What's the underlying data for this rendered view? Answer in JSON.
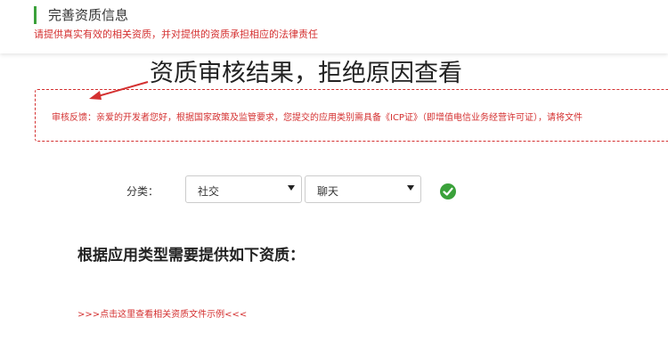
{
  "header": {
    "title": "完善资质信息",
    "subtitle": "请提供真实有效的相关资质，并对提供的资质承担相应的法律责任",
    "accent_color": "#3aa13a"
  },
  "annotation": {
    "text": "资质审核结果，拒绝原因查看"
  },
  "feedback": {
    "text": "审核反馈：亲爱的开发者您好，根据国家政策及监管要求，您提交的应用类别需具备《ICP证》（即增值电信业务经营许可证），请将文件",
    "border_color": "#d43030"
  },
  "category": {
    "label": "分类：",
    "primary_value": "社交",
    "secondary_value": "聊天",
    "status_icon": "check-circle-icon"
  },
  "requirements": {
    "heading": "根据应用类型需要提供如下资质：",
    "sample_link": ">>>点击这里查看相关资质文件示例<<<"
  }
}
